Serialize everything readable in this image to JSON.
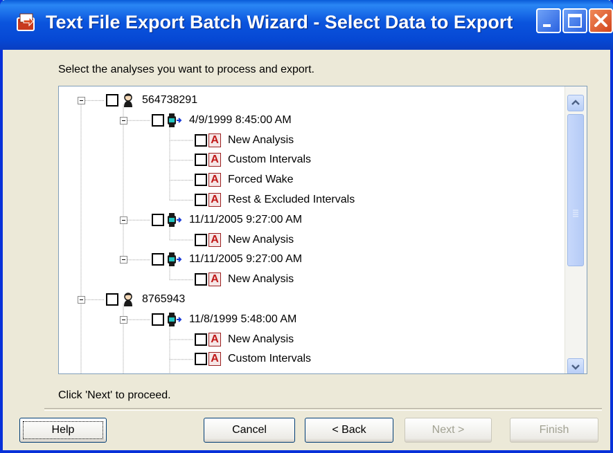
{
  "window": {
    "title": "Text File Export Batch Wizard - Select Data to Export",
    "accent_color": "#0a54dc"
  },
  "instruction": "Select the analyses you want to process and export.",
  "tree": {
    "rows": [
      {
        "level": 0,
        "type": "subject",
        "label": "564738291",
        "icon": "person-icon",
        "expander": true
      },
      {
        "level": 1,
        "type": "recording",
        "label": "4/9/1999 8:45:00 AM",
        "icon": "watch-icon",
        "expander": true
      },
      {
        "level": 2,
        "type": "analysis",
        "label": "New Analysis",
        "icon": "analysis-icon"
      },
      {
        "level": 2,
        "type": "analysis",
        "label": "Custom Intervals",
        "icon": "analysis-icon"
      },
      {
        "level": 2,
        "type": "analysis",
        "label": "Forced Wake",
        "icon": "analysis-icon"
      },
      {
        "level": 2,
        "type": "analysis",
        "label": "Rest & Excluded Intervals",
        "icon": "analysis-icon"
      },
      {
        "level": 1,
        "type": "recording",
        "label": "11/11/2005 9:27:00 AM",
        "icon": "watch-icon",
        "expander": true
      },
      {
        "level": 2,
        "type": "analysis",
        "label": "New Analysis",
        "icon": "analysis-icon"
      },
      {
        "level": 1,
        "type": "recording",
        "label": "11/11/2005 9:27:00 AM",
        "icon": "watch-icon",
        "expander": true
      },
      {
        "level": 2,
        "type": "analysis",
        "label": "New Analysis",
        "icon": "analysis-icon"
      },
      {
        "level": 0,
        "type": "subject",
        "label": "8765943",
        "icon": "person-icon",
        "expander": true
      },
      {
        "level": 1,
        "type": "recording",
        "label": "11/8/1999 5:48:00 AM",
        "icon": "watch-icon",
        "expander": true
      },
      {
        "level": 2,
        "type": "analysis",
        "label": "New Analysis",
        "icon": "analysis-icon"
      },
      {
        "level": 2,
        "type": "analysis",
        "label": "Custom Intervals",
        "icon": "analysis-icon"
      }
    ]
  },
  "footer_text": "Click 'Next' to proceed.",
  "buttons": {
    "help": "Help",
    "cancel": "Cancel",
    "back": "< Back",
    "next": "Next >",
    "finish": "Finish"
  }
}
